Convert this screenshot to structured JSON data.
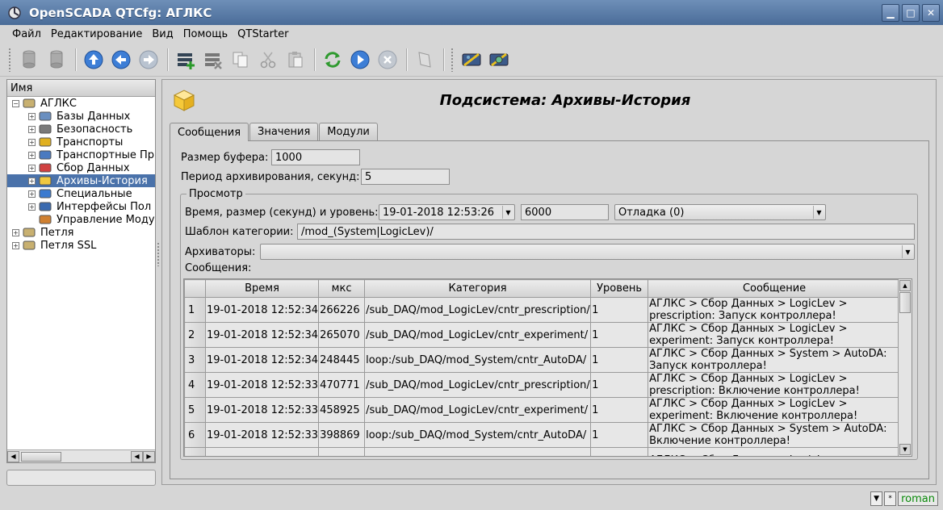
{
  "window": {
    "title": "OpenSCADA QTCfg: АГЛКС"
  },
  "menu": [
    "Файл",
    "Редактирование",
    "Вид",
    "Помощь",
    "QTStarter"
  ],
  "toolbar": {
    "groups": [
      [
        "db-load-icon",
        "db-save-icon"
      ],
      [
        "up-icon",
        "back-icon",
        "forward-icon"
      ],
      [
        "add-item-icon",
        "delete-item-icon",
        "copy-icon",
        "cut-icon",
        "paste-icon"
      ],
      [
        "refresh-icon",
        "start-icon",
        "stop-icon",
        "info-icon"
      ],
      [
        "vision-icon",
        "visual-edit-icon"
      ]
    ]
  },
  "tree": {
    "header": "Имя",
    "items": [
      {
        "label": "АГЛКС",
        "level": 0,
        "expander": "−",
        "icon": "station-icon"
      },
      {
        "label": "Базы Данных",
        "level": 1,
        "expander": "+",
        "icon": "database-icon"
      },
      {
        "label": "Безопасность",
        "level": 1,
        "expander": "+",
        "icon": "security-icon"
      },
      {
        "label": "Транспорты",
        "level": 1,
        "expander": "+",
        "icon": "transport-icon"
      },
      {
        "label": "Транспортные Пр",
        "level": 1,
        "expander": "+",
        "icon": "protocol-icon"
      },
      {
        "label": "Сбор Данных",
        "level": 1,
        "expander": "+",
        "icon": "daq-icon"
      },
      {
        "label": "Архивы-История",
        "level": 1,
        "expander": "+",
        "icon": "archive-icon",
        "selected": true
      },
      {
        "label": "Специальные",
        "level": 1,
        "expander": "+",
        "icon": "special-icon"
      },
      {
        "label": "Интерфейсы Пол",
        "level": 1,
        "expander": "+",
        "icon": "ui-icon"
      },
      {
        "label": "Управление Моду",
        "level": 1,
        "expander": "",
        "icon": "modules-icon"
      },
      {
        "label": "Петля",
        "level": 0,
        "expander": "+",
        "icon": "station-icon"
      },
      {
        "label": "Петля SSL",
        "level": 0,
        "expander": "+",
        "icon": "station-icon"
      }
    ]
  },
  "page": {
    "title": "Подсистема: Архивы-История",
    "tabs": [
      "Сообщения",
      "Значения",
      "Модули"
    ],
    "active_tab": 0,
    "buffer_label": "Размер буфера:",
    "buffer_value": "1000",
    "period_label": "Период архивирования, секунд:",
    "period_value": "5",
    "view_group": "Просмотр",
    "time_label": "Время, размер (секунд) и уровень:",
    "time_value": "19-01-2018 12:53:26",
    "size_value": "6000",
    "level_value": "Отладка (0)",
    "category_label": "Шаблон категории:",
    "category_value": "/mod_(System|LogicLev)/",
    "archivers_label": "Архиваторы:",
    "archivers_value": "",
    "messages_label": "Сообщения:"
  },
  "table": {
    "columns": [
      "Время",
      "мкс",
      "Категория",
      "Уровень",
      "Сообщение"
    ],
    "rows": [
      {
        "n": "1",
        "time": "19-01-2018 12:52:34",
        "usec": "266226",
        "category": "/sub_DAQ/mod_LogicLev/cntr_prescription/",
        "level": "1",
        "message": "АГЛКС > Сбор Данных > LogicLev > prescription: Запуск контроллера!"
      },
      {
        "n": "2",
        "time": "19-01-2018 12:52:34",
        "usec": "265070",
        "category": "/sub_DAQ/mod_LogicLev/cntr_experiment/",
        "level": "1",
        "message": "АГЛКС > Сбор Данных > LogicLev > experiment: Запуск контроллера!"
      },
      {
        "n": "3",
        "time": "19-01-2018 12:52:34",
        "usec": "248445",
        "category": "loop:/sub_DAQ/mod_System/cntr_AutoDA/",
        "level": "1",
        "message": "АГЛКС > Сбор Данных > System > AutoDA: Запуск контроллера!"
      },
      {
        "n": "4",
        "time": "19-01-2018 12:52:33",
        "usec": "470771",
        "category": "/sub_DAQ/mod_LogicLev/cntr_prescription/",
        "level": "1",
        "message": "АГЛКС > Сбор Данных > LogicLev > prescription: Включение контроллера!"
      },
      {
        "n": "5",
        "time": "19-01-2018 12:52:33",
        "usec": "458925",
        "category": "/sub_DAQ/mod_LogicLev/cntr_experiment/",
        "level": "1",
        "message": "АГЛКС > Сбор Данных > LogicLev > experiment: Включение контроллера!"
      },
      {
        "n": "6",
        "time": "19-01-2018 12:52:33",
        "usec": "398869",
        "category": "loop:/sub_DAQ/mod_System/cntr_AutoDA/",
        "level": "1",
        "message": "АГЛКС > Сбор Данных > System > AutoDA: Включение контроллера!"
      },
      {
        "n": "",
        "time": "",
        "usec": "",
        "category": "",
        "level": "",
        "message": "АГЛКС > Сбор Данных > LogicLev >"
      }
    ]
  },
  "statusbar": {
    "user": "roman",
    "star": "*"
  },
  "colors": {
    "selection": "#4a72aa",
    "titlebar": "#5a7ca8",
    "user_text": "#0a8a0a"
  }
}
